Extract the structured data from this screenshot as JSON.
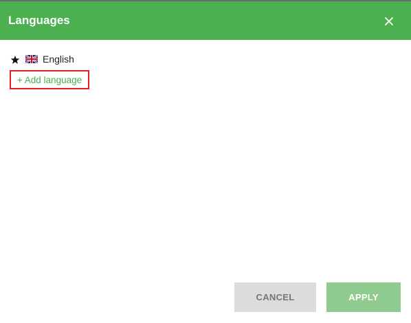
{
  "dialog": {
    "title": "Languages",
    "close_icon": "close-icon"
  },
  "languages": [
    {
      "name": "English",
      "is_default": true,
      "default_icon": "star-icon",
      "flag_icon": "uk-flag-icon"
    }
  ],
  "add_language_label": "+ Add language",
  "buttons": {
    "cancel_label": "CANCEL",
    "apply_label": "APPLY"
  },
  "colors": {
    "header": "#4caf50",
    "accent": "#4caf50",
    "apply_button": "#8fcb8f",
    "cancel_button": "#dcdcdc",
    "highlight_border": "#e02020"
  }
}
